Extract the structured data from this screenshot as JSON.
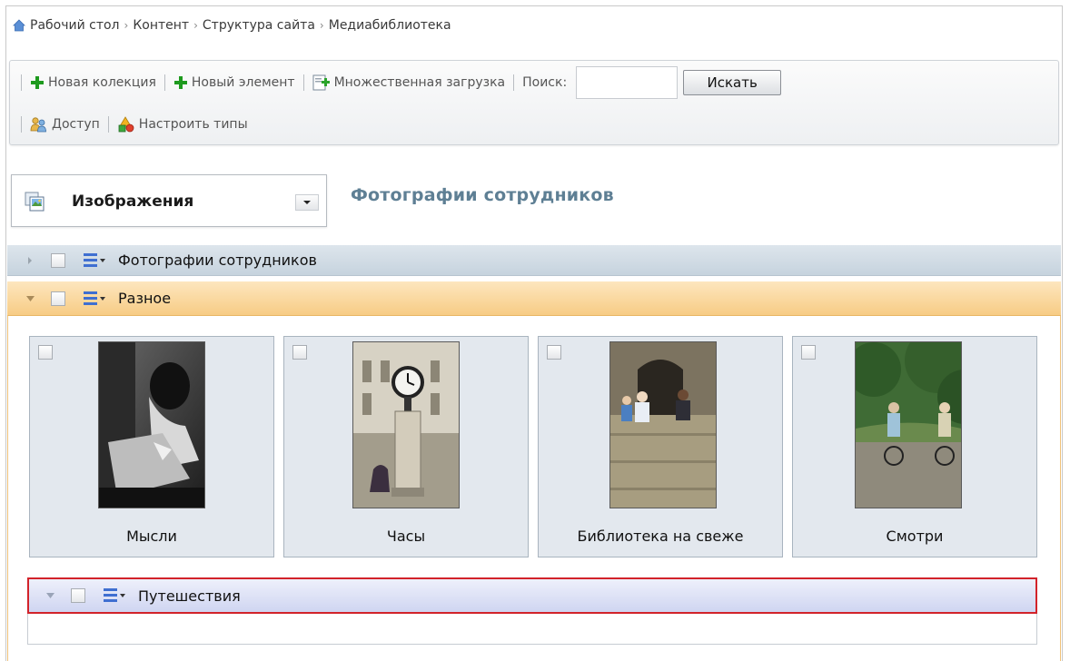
{
  "breadcrumb": {
    "items": [
      "Рабочий стол",
      "Контент",
      "Структура сайта",
      "Медиабиблиотека"
    ]
  },
  "toolbar": {
    "new_collection_label": "Новая колекция",
    "new_element_label": "Новый элемент",
    "bulk_upload_label": "Множественная загрузка",
    "search_label": "Поиск:",
    "search_value": "",
    "search_button_label": "Искать",
    "access_label": "Доступ",
    "configure_types_label": "Настроить типы"
  },
  "type_selector": {
    "selected": "Изображения"
  },
  "section_title": "Фотографии сотрудников",
  "tree": {
    "employees": {
      "label": "Фотографии сотрудников",
      "expanded": false
    },
    "misc": {
      "label": "Разное",
      "expanded": true
    },
    "travel": {
      "label": "Путешествия",
      "expanded": true,
      "highlighted": true
    }
  },
  "cards": [
    {
      "caption": "Мысли",
      "thumbnail": "photo-person-reading"
    },
    {
      "caption": "Часы",
      "thumbnail": "photo-street-clock"
    },
    {
      "caption": "Библиотека на свеже",
      "thumbnail": "photo-people-on-wall"
    },
    {
      "caption": "Смотри",
      "thumbnail": "photo-cyclists-in-park"
    }
  ],
  "colors": {
    "accent_blue": "#5e7f94",
    "active_row_orange": "#f7cc85",
    "highlight_border": "#d2232a",
    "plus_green": "#1e9a1e"
  }
}
